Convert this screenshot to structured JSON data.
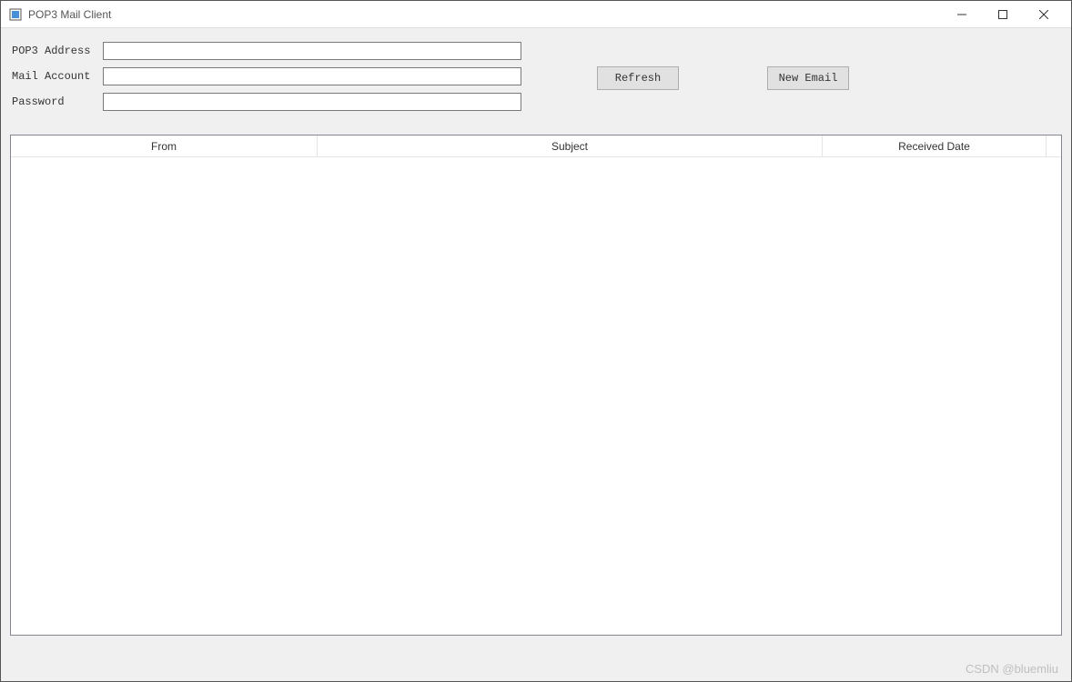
{
  "window": {
    "title": "POP3 Mail Client"
  },
  "form": {
    "pop3_address_label": "POP3 Address",
    "pop3_address_value": "",
    "mail_account_label": "Mail Account",
    "mail_account_value": "",
    "password_label": "Password",
    "password_value": ""
  },
  "buttons": {
    "refresh": "Refresh",
    "new_email": "New Email"
  },
  "table": {
    "headers": {
      "from": "From",
      "subject": "Subject",
      "received_date": "Received Date"
    },
    "rows": []
  },
  "watermark": "CSDN @bluemliu"
}
